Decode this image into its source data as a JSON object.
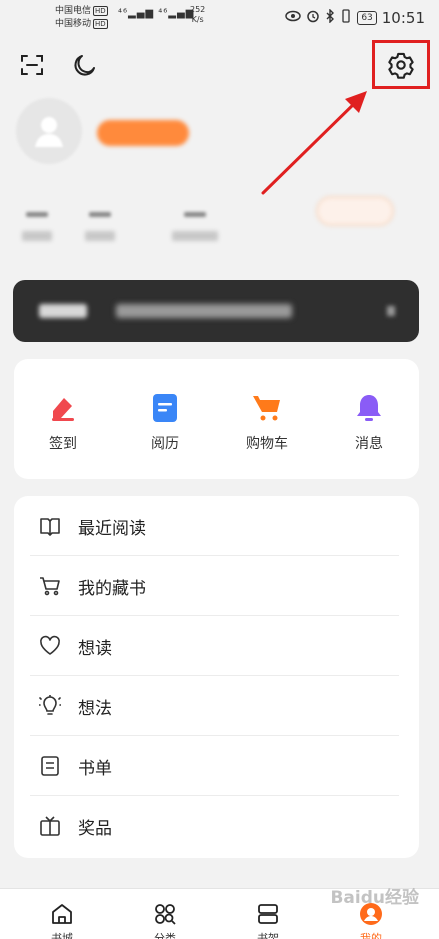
{
  "status_bar": {
    "carrier1": "中国电信",
    "carrier2": "中国移动",
    "hd": "HD",
    "signal": "⁴⁶▂▄▆ ⁴⁶▂▄▆",
    "speed_value": "252",
    "speed_unit": "K/s",
    "battery": "63",
    "time": "10:51"
  },
  "quick_actions": [
    {
      "label": "签到",
      "icon": "checkin-icon",
      "color": "#f0484e"
    },
    {
      "label": "阅历",
      "icon": "reading-history-icon",
      "color": "#3a86f7"
    },
    {
      "label": "购物车",
      "icon": "shopping-cart-icon",
      "color": "#ff7a1a"
    },
    {
      "label": "消息",
      "icon": "bell-icon",
      "color": "#8a5cf6"
    }
  ],
  "menu": [
    {
      "label": "最近阅读",
      "icon": "open-book-icon"
    },
    {
      "label": "我的藏书",
      "icon": "cart-icon"
    },
    {
      "label": "想读",
      "icon": "heart-icon"
    },
    {
      "label": "想法",
      "icon": "lightbulb-icon"
    },
    {
      "label": "书单",
      "icon": "list-icon"
    },
    {
      "label": "奖品",
      "icon": "gift-icon"
    }
  ],
  "bottom_nav": [
    {
      "label": "书城",
      "icon": "home-icon",
      "active": false
    },
    {
      "label": "分类",
      "icon": "category-icon",
      "active": false
    },
    {
      "label": "书架",
      "icon": "bookshelf-icon",
      "active": false
    },
    {
      "label": "我的",
      "icon": "profile-icon",
      "active": true
    }
  ],
  "watermark": "Baidu经验",
  "colors": {
    "accent": "#ff6a1a",
    "annotation": "#e02020",
    "background": "#f2f2f2"
  }
}
